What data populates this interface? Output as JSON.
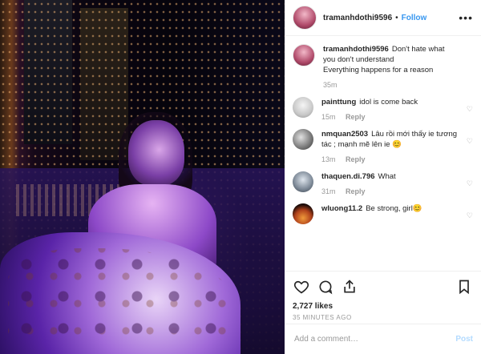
{
  "header": {
    "username": "tramanhdothi9596",
    "separator": "•",
    "follow_label": "Follow",
    "more_label": "•••"
  },
  "caption": {
    "username": "tramanhdothi9596",
    "text_line1": "Don't hate what you don't understand",
    "text_line2": "Everything happens for a reason",
    "time": "35m"
  },
  "comments": [
    {
      "username": "painttung",
      "text": "idol is come back",
      "time": "15m",
      "reply_label": "Reply"
    },
    {
      "username": "nmquan2503",
      "text": "Lâu rồi mới thấy ie tương tác ; mạnh mẽ lên ie 😊",
      "time": "13m",
      "reply_label": "Reply"
    },
    {
      "username": "thaquen.di.796",
      "text": "What",
      "time": "31m",
      "reply_label": "Reply"
    },
    {
      "username": "wluong11.2",
      "text": "Be strong, girl😊",
      "time": "",
      "reply_label": ""
    }
  ],
  "likes": "2,727 likes",
  "posted": "35 MINUTES AGO",
  "add_comment": {
    "placeholder": "Add a comment…",
    "post_label": "Post"
  },
  "colors": {
    "accent": "#3897f0",
    "post_disabled": "#b3dbff",
    "muted": "#999999"
  },
  "icons": [
    "heart-icon",
    "comment-icon",
    "share-icon",
    "bookmark-icon"
  ]
}
